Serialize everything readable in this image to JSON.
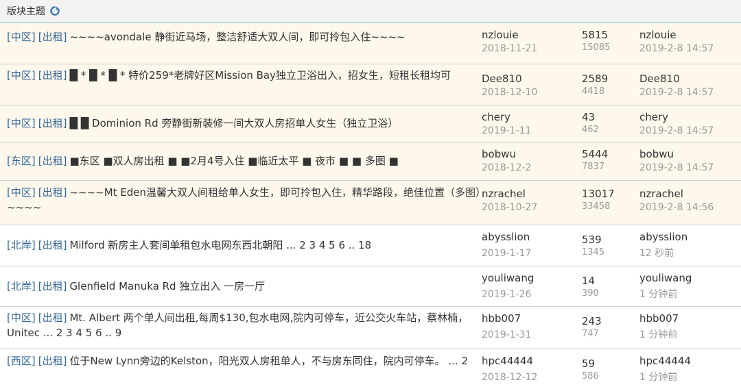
{
  "header": {
    "title": "版块主题"
  },
  "threads": [
    {
      "tags": [
        "[中区]",
        "[出租]"
      ],
      "title": "~~~~avondale 静街近马场，整洁舒适大双人间，即可拎包入住~~~~",
      "author": "nzlouie",
      "created": "2018-11-21",
      "replies": "5815",
      "views": "15085",
      "last_user": "nzlouie",
      "last_time": "2019-2-8 14:57"
    },
    {
      "tags": [
        "[中区]",
        "[出租]"
      ],
      "title": "█ * █ * █ * 特价259*老牌好区Mission Bay独立卫浴出入，招女生，短租长租均可",
      "author": "Dee810",
      "created": "2018-12-10",
      "replies": "2589",
      "views": "4418",
      "last_user": "Dee810",
      "last_time": "2019-2-8 14:57"
    },
    {
      "tags": [
        "[中区]",
        "[出租]"
      ],
      "title": "█ █ Dominion Rd 旁静街新装修一间大双人房招单人女生（独立卫浴）",
      "author": "chery",
      "created": "2019-1-11",
      "replies": "43",
      "views": "462",
      "last_user": "chery",
      "last_time": "2019-2-8 14:57"
    },
    {
      "tags": [
        "[东区]",
        "[出租]"
      ],
      "title": "■东区 ■双人房出租 ■ ■2月4号入住 ■临近太平 ■ 夜市 ■ ■ 多图 ■",
      "author": "bobwu",
      "created": "2018-12-2",
      "replies": "5444",
      "views": "7837",
      "last_user": "bobwu",
      "last_time": "2019-2-8 14:57"
    },
    {
      "tags": [
        "[中区]",
        "[出租]"
      ],
      "title": "~~~~Mt Eden温馨大双人间租给单人女生，即可拎包入住，精华路段，绝佳位置（多图）~~~~",
      "author": "nzrachel",
      "created": "2018-10-27",
      "replies": "13017",
      "views": "33458",
      "last_user": "nzrachel",
      "last_time": "2019-2-8 14:56"
    },
    {
      "tags": [
        "[北岸]",
        "[出租]"
      ],
      "title": "Milford 新房主人套间单租包水电网东西北朝阳  ... 2  3  4  5  6 .. 18",
      "author": "abysslion",
      "created": "2019-1-17",
      "replies": "539",
      "views": "1345",
      "last_user": "abysslion",
      "last_time": "12 秒前"
    },
    {
      "tags": [
        "[北岸]",
        "[出租]"
      ],
      "title": "Glenfield Manuka Rd 独立出入 一房一厅",
      "author": "youliwang",
      "created": "2019-1-26",
      "replies": "14",
      "views": "390",
      "last_user": "youliwang",
      "last_time": "1 分钟前"
    },
    {
      "tags": [
        "[中区]",
        "[出租]"
      ],
      "title": "Mt. Albert 两个单人间出租,每周$130,包水电网,院内可停车，近公交火车站，蔡林楠，Unitec  ... 2  3  4  5  6 .. 9",
      "author": "hbb007",
      "created": "2019-1-31",
      "replies": "243",
      "views": "747",
      "last_user": "hbb007",
      "last_time": "1 分钟前"
    },
    {
      "tags": [
        "[西区]",
        "[出租]"
      ],
      "title": "位于New Lynn旁边的Kelston，阳光双人房租单人，不与房东同住，院内可停车。  ... 2",
      "author": "hpc44444",
      "created": "2018-12-12",
      "replies": "59",
      "views": "586",
      "last_user": "hpc44444",
      "last_time": "1 分钟前"
    }
  ]
}
